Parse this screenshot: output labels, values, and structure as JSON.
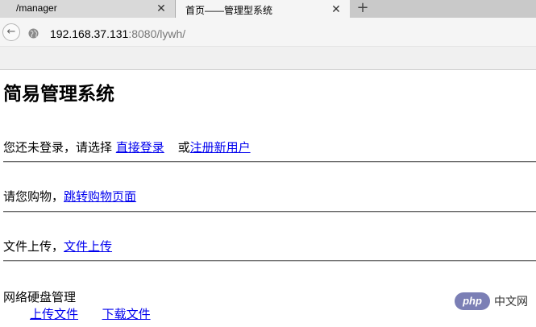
{
  "tabs": [
    {
      "title": "/manager"
    },
    {
      "title": "首页——管理型系统"
    }
  ],
  "tab_close_glyph": "✕",
  "new_tab_glyph": "+",
  "icons": {
    "back": "back-arrow-icon",
    "site": "globe-icon",
    "close": "close-icon",
    "new_tab": "plus-icon"
  },
  "address": {
    "host": "192.168.37.131",
    "rest": ":8080/lywh/"
  },
  "page": {
    "title": "简易管理系统",
    "login_prompt": "您还未登录，请选择 ",
    "login_link": "直接登录",
    "or_text": "或",
    "register_link": "注册新用户",
    "shop_prompt": "请您购物，",
    "shop_link": "跳转购物页面",
    "upload_prompt": "文件上传，",
    "upload_link": "文件上传",
    "disk_title": "网络硬盘管理",
    "disk_upload_link": "上传文件",
    "disk_download_link": "下载文件"
  },
  "watermark": {
    "logo": "php",
    "text": "中文网"
  },
  "colors": {
    "link": "#0000ee",
    "tabstrip": "#c9c9c9",
    "active_tab": "#f5f5f5",
    "watermark_logo": "#7b7fb5"
  }
}
